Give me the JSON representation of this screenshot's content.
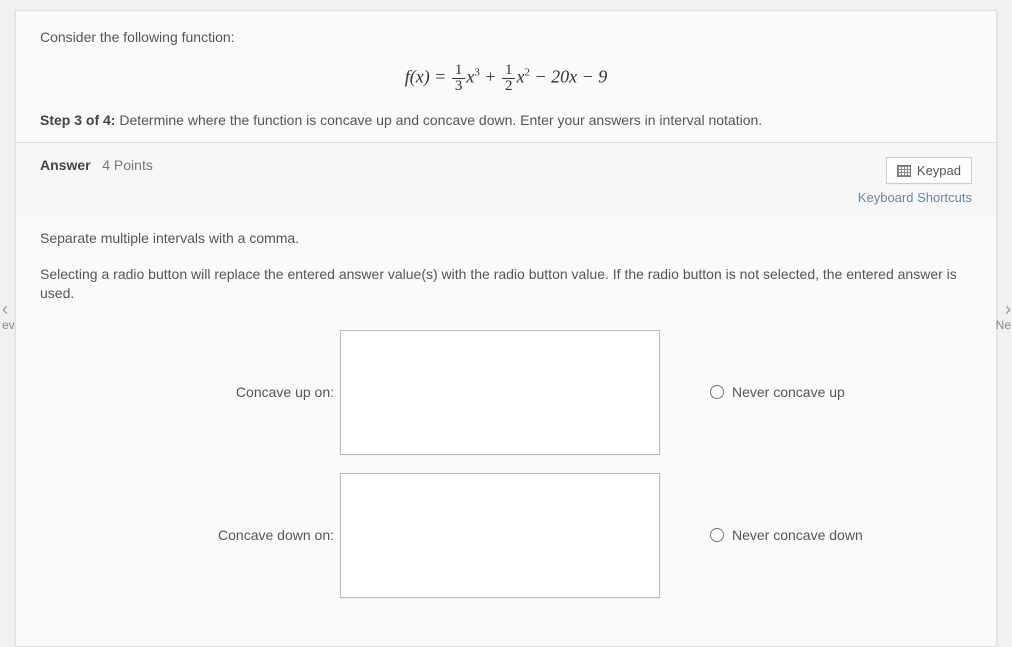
{
  "question": {
    "prompt": "Consider the following function:",
    "formula_parts": {
      "fx": "f(x) = ",
      "frac1_num": "1",
      "frac1_den": "3",
      "x3": "x",
      "sup3": "3",
      "plus": " + ",
      "frac2_num": "1",
      "frac2_den": "2",
      "x2": "x",
      "sup2": "2",
      "tail": " − 20x − 9"
    },
    "step_label": "Step 3 of 4:",
    "step_text": " Determine where the function is concave up and concave down. Enter your answers in interval notation."
  },
  "answer_bar": {
    "answer_label": "Answer",
    "points": "4 Points",
    "keypad": "Keypad",
    "keyboard_shortcuts": "Keyboard Shortcuts"
  },
  "instructions": {
    "line1": "Separate multiple intervals with a comma.",
    "line2": "Selecting a radio button will replace the entered answer value(s) with the radio button value. If the radio button is not selected, the entered answer is used."
  },
  "inputs": {
    "concave_up_label": "Concave up on:",
    "concave_up_value": "",
    "never_up_label": "Never concave up",
    "concave_down_label": "Concave down on:",
    "concave_down_value": "",
    "never_down_label": "Never concave down"
  },
  "nav": {
    "prev": "ev",
    "next": "Ne"
  }
}
